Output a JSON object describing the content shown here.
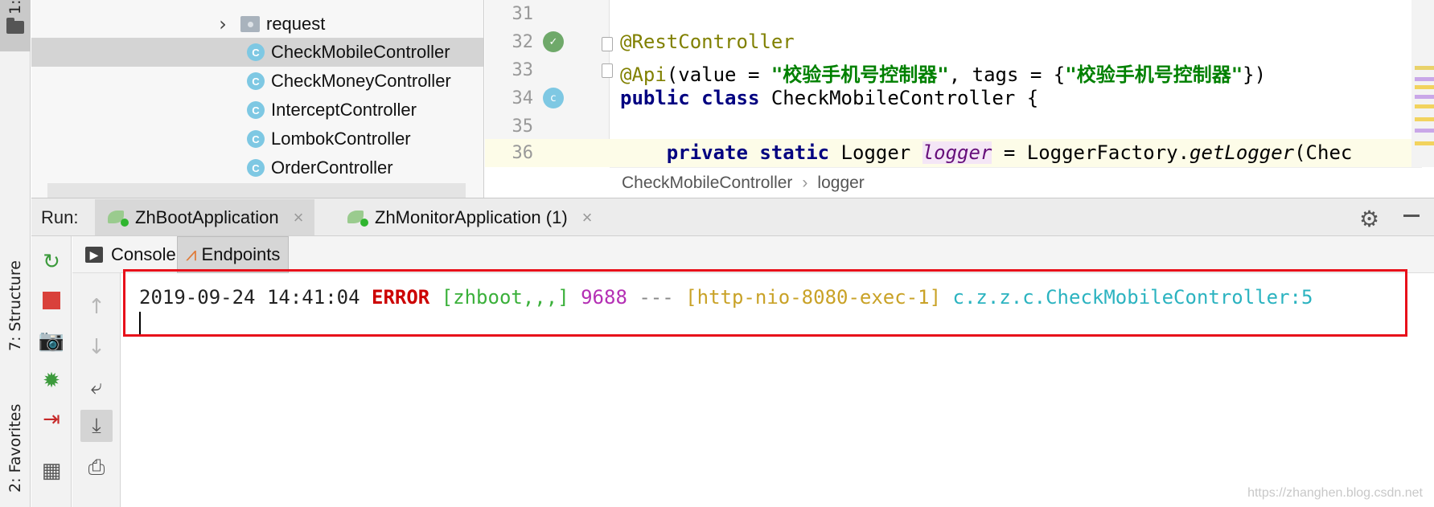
{
  "left_strip": {
    "project_tab_number": "1:",
    "structure_tab": "7: Structure",
    "favorites_tab": "2: Favorites"
  },
  "project_tree": {
    "items": [
      {
        "label": "request",
        "kind": "package"
      },
      {
        "label": "CheckMobileController",
        "kind": "class",
        "selected": true
      },
      {
        "label": "CheckMoneyController",
        "kind": "class"
      },
      {
        "label": "InterceptController",
        "kind": "class"
      },
      {
        "label": "LombokController",
        "kind": "class"
      },
      {
        "label": "OrderController",
        "kind": "class"
      }
    ]
  },
  "editor": {
    "lines": [
      {
        "num": "31"
      },
      {
        "num": "32",
        "t1": "@RestController"
      },
      {
        "num": "33",
        "t1": "@Api",
        "t2": "(value = ",
        "t3": "\"校验手机号控制器\"",
        "t4": ", tags = {",
        "t5": "\"校验手机号控制器\"",
        "t6": "})"
      },
      {
        "num": "34",
        "t1": "public",
        "t2": " ",
        "t3": "class",
        "t4": " CheckMobileController {"
      },
      {
        "num": "35"
      },
      {
        "num": "36",
        "t1": "    ",
        "t2": "private",
        "t3": " ",
        "t4": "static",
        "t5": " Logger ",
        "t6": "logger",
        "t7": " = LoggerFactory.",
        "t8": "getLogger",
        "t9": "(Chec"
      }
    ],
    "gutter_class_badge": "c",
    "class_badge": "C",
    "breadcrumb": {
      "class": "CheckMobileController",
      "sep": "›",
      "member": "logger"
    }
  },
  "run_panel": {
    "label": "Run:",
    "tabs": [
      {
        "label": "ZhBootApplication",
        "active": true
      },
      {
        "label": "ZhMonitorApplication (1)",
        "active": false
      }
    ],
    "close_glyph": "×",
    "console_tabs": [
      {
        "label": "Console",
        "active": false
      },
      {
        "label": "Endpoints",
        "active": true
      }
    ]
  },
  "console": {
    "timestamp": "2019-09-24 14:41:04",
    "level": "ERROR",
    "app": "[zhboot,,,]",
    "pid": "9688",
    "separator": "---",
    "thread": "[http-nio-8080-exec-1]",
    "logger": "c.z.z.c.CheckMobileController:5"
  },
  "watermark": "https://zhanghen.blog.csdn.net",
  "colors": {
    "highlight_box": "#e8101a",
    "error": "#cc0000",
    "app": "#3ab03a",
    "pid": "#b42fb4",
    "thread": "#c9a227",
    "logger": "#2bb3c0"
  },
  "icons": [
    "folder-icon",
    "chevron-right-icon",
    "package-icon",
    "class-icon",
    "spring-boot-icon",
    "close-icon",
    "gear-icon",
    "minimize-icon",
    "rerun-icon",
    "stop-icon",
    "camera-icon",
    "debug-icon",
    "import-icon",
    "layout-icon",
    "up-arrow-icon",
    "down-arrow-icon",
    "soft-wrap-icon",
    "scroll-to-end-icon",
    "print-icon",
    "console-icon",
    "endpoints-icon"
  ]
}
